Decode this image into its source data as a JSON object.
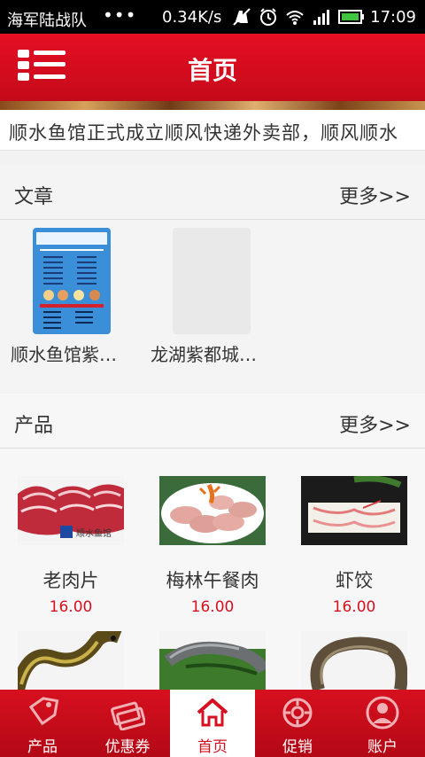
{
  "status_bar": {
    "carrier": "海军陆战队",
    "dots": "•••",
    "speed": "0.34K/s",
    "time": "17:09",
    "icons": [
      "mute-icon",
      "alarm-icon",
      "wifi-icon",
      "signal-icon",
      "battery-icon"
    ]
  },
  "header": {
    "title": "首页",
    "menu_icon": "list-menu-icon"
  },
  "marquee": {
    "text": "顺水鱼馆正式成立顺风快递外卖部，顺风顺水"
  },
  "articles": {
    "title": "文章",
    "more": "更多>>",
    "items": [
      {
        "caption": "顺水鱼馆紫…",
        "image": "menu-poster"
      },
      {
        "caption": "龙湖紫都城…",
        "image": "placeholder"
      }
    ]
  },
  "products": {
    "title": "产品",
    "more": "更多>>",
    "items": [
      {
        "name": "老肉片",
        "price": "16.00",
        "image": "sliced-meat"
      },
      {
        "name": "梅林午餐肉",
        "price": "16.00",
        "image": "luncheon-meat"
      },
      {
        "name": "虾饺",
        "price": "16.00",
        "image": "shrimp-dumpling"
      },
      {
        "name": "",
        "price": "",
        "image": "eel"
      },
      {
        "name": "",
        "price": "",
        "image": "fish"
      },
      {
        "name": "",
        "price": "",
        "image": "catfish"
      }
    ]
  },
  "bottom_nav": {
    "items": [
      {
        "label": "产品",
        "icon": "tag-icon",
        "active": false
      },
      {
        "label": "优惠券",
        "icon": "coupon-icon",
        "active": false
      },
      {
        "label": "首页",
        "icon": "home-icon",
        "active": true
      },
      {
        "label": "促销",
        "icon": "promo-icon",
        "active": false
      },
      {
        "label": "账户",
        "icon": "user-icon",
        "active": false
      }
    ]
  },
  "colors": {
    "brand_red": "#d51020",
    "price_red": "#d51020",
    "status_bar_bg": "#000000"
  }
}
